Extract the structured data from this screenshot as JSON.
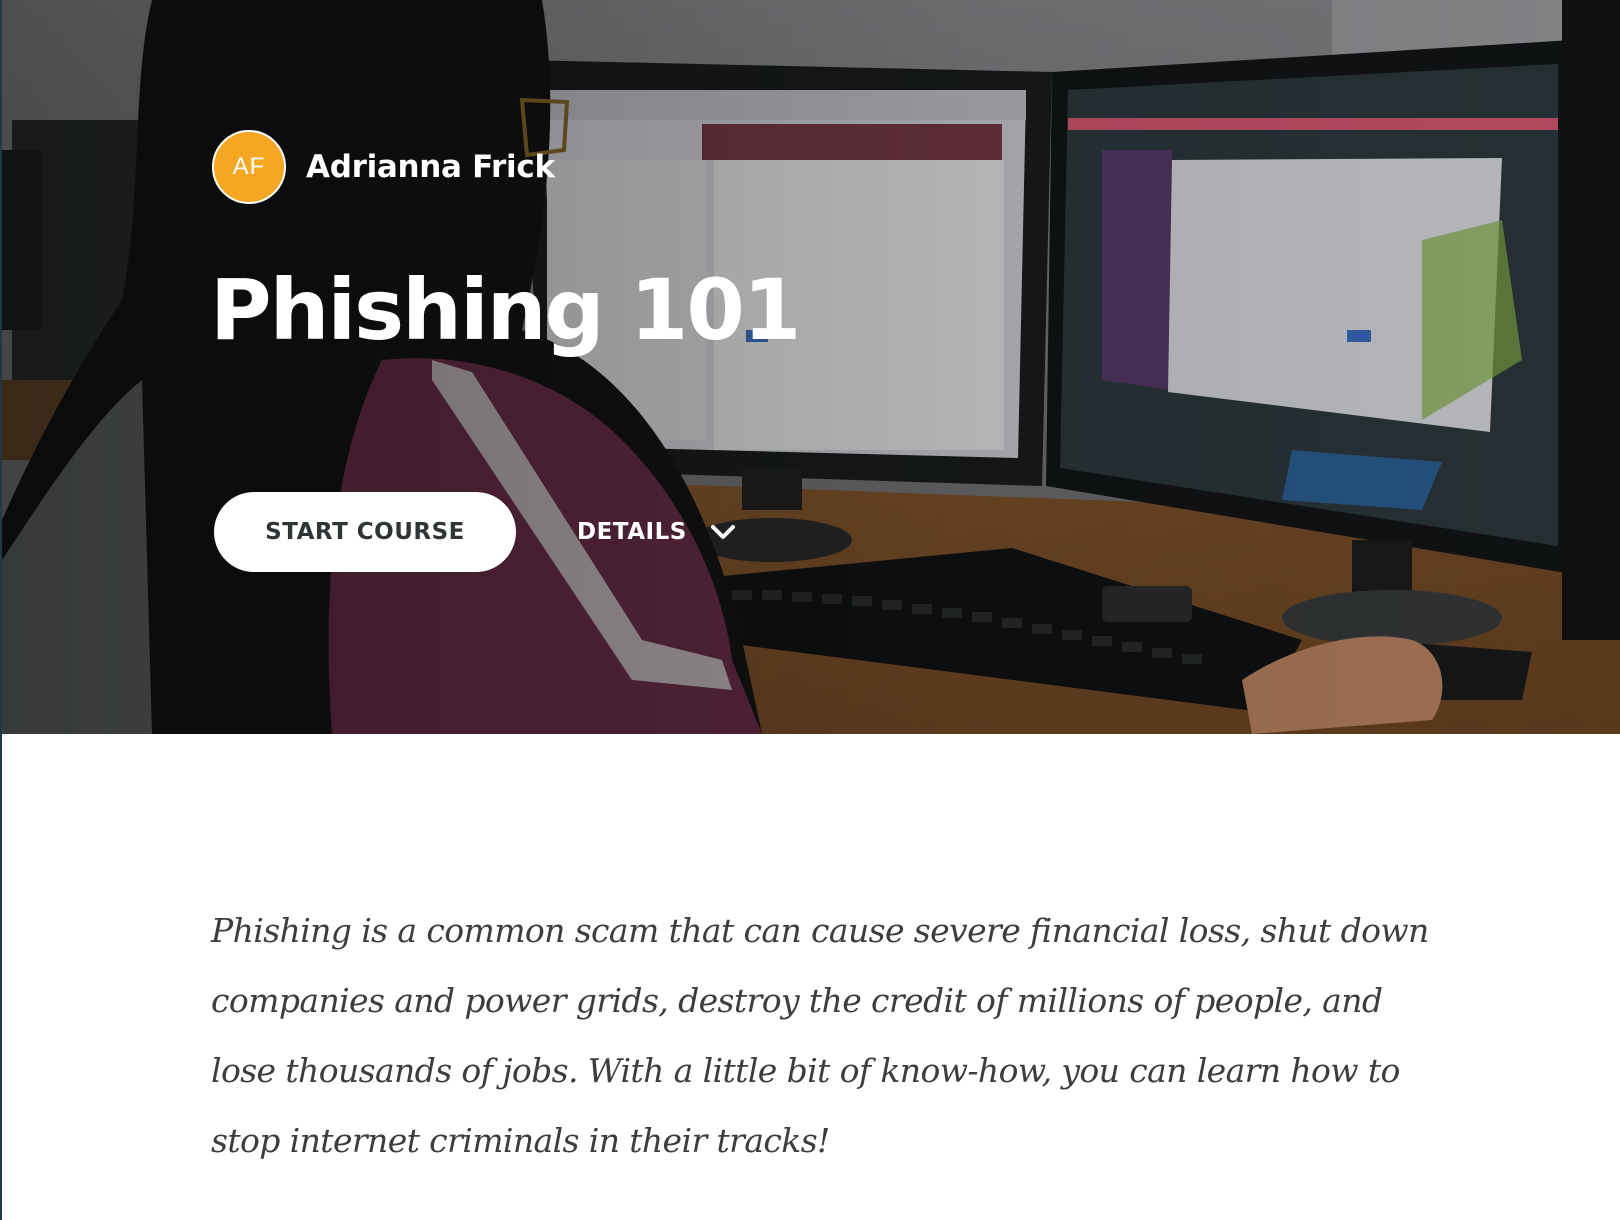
{
  "author": {
    "initials": "AF",
    "name": "Adrianna Frick"
  },
  "course": {
    "title": "Phishing 101",
    "start_label": "START COURSE",
    "details_label": "DETAILS",
    "description": "Phishing is a common scam that can cause severe financial loss, shut down companies and power grids, destroy the credit of millions of people, and lose thousands of jobs. With a little bit of know-how, you can learn how to stop internet criminals in their tracks!"
  },
  "icons": {
    "details_toggle": "chevron-down-icon"
  },
  "colors": {
    "avatar_bg": "#f5a623",
    "button_bg": "#ffffff",
    "button_text": "#2f3437",
    "hero_text": "#ffffff",
    "body_text": "#3d3d3d"
  }
}
